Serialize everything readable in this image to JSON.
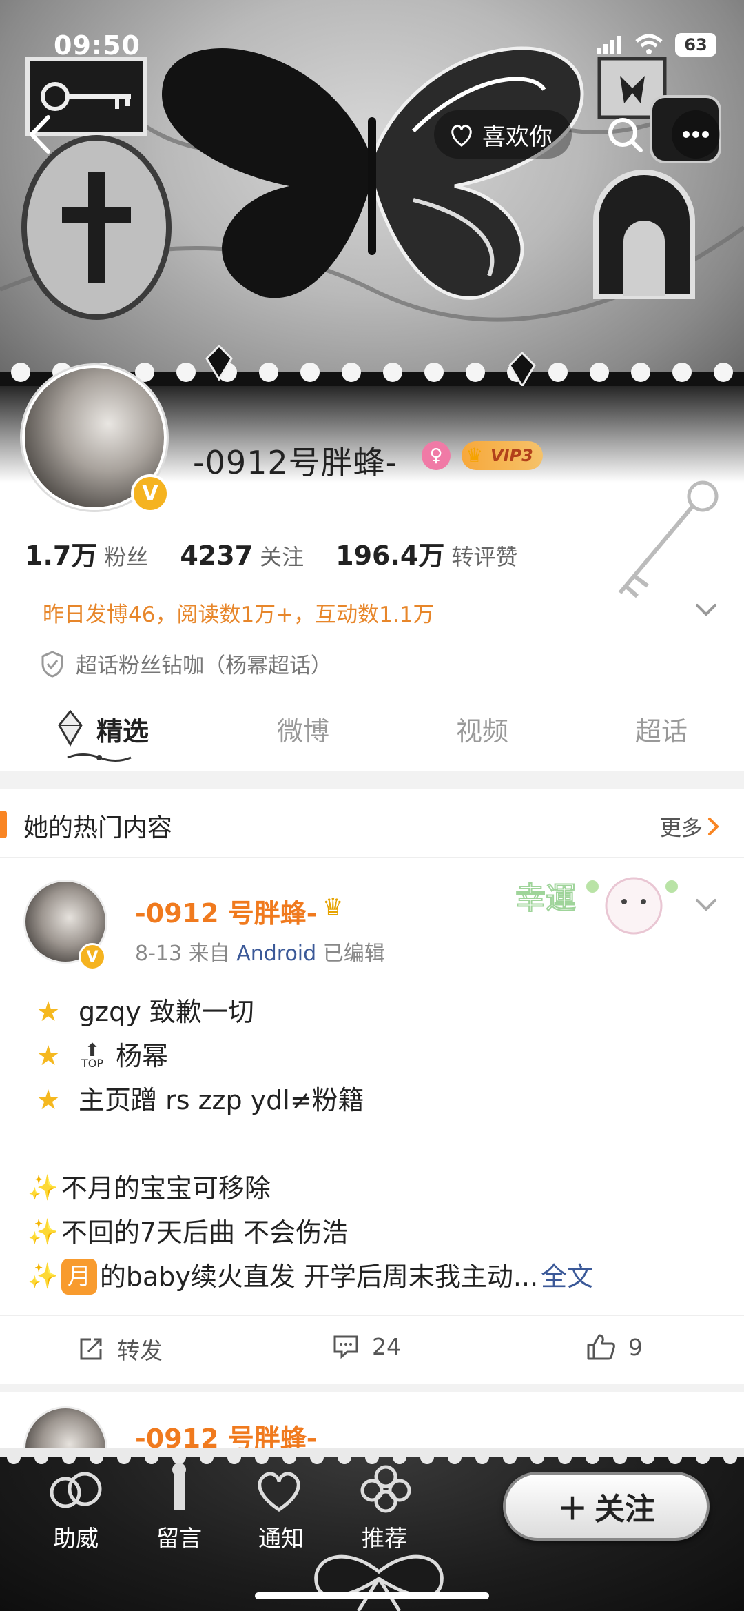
{
  "status": {
    "time": "09:50",
    "battery": "63"
  },
  "topnav": {
    "like_label": "喜欢你"
  },
  "profile": {
    "username": "-0912号胖蜂-",
    "gender_icon": "♀",
    "vip_label": "VIP3",
    "stats": [
      {
        "num": "1.7万",
        "label": "粉丝"
      },
      {
        "num": "4237",
        "label": "关注"
      },
      {
        "num": "196.4万",
        "label": "转评赞"
      }
    ],
    "yesterday_stats": "昨日发博46，阅读数1万+，互动数1.1万",
    "topic_badge": "超话粉丝钻咖（杨幂超话）"
  },
  "tabs": [
    "精选",
    "微博",
    "视频",
    "超话"
  ],
  "hot": {
    "title": "她的热门内容",
    "more": "更多"
  },
  "post": {
    "author": "-0912 号胖蜂-",
    "date": "8-13",
    "from_prefix": "来自",
    "source": "Android",
    "edited": "已编辑",
    "lines": {
      "l1": "gzqy 致歉一切",
      "l2_top": "TOP",
      "l2": "杨幂",
      "l3": "主页蹭 rs zzp ydl≠粉籍",
      "l4": "不月的宝宝可移除",
      "l5": "不回的7天后曲 不会伤浩",
      "l6_tag": "月",
      "l6": "的baby续火直发 开学后周末我主动...",
      "full_text": "全文"
    },
    "actions": {
      "repost": "转发",
      "comments": "24",
      "likes": "9"
    },
    "sticker_text": "幸運"
  },
  "post2": {
    "author": "-0912 号胖蜂-"
  },
  "bottombar": {
    "items": [
      "助威",
      "留言",
      "通知",
      "推荐"
    ],
    "follow": "关注"
  },
  "colors": {
    "accent_orange": "#f07a1e",
    "link_blue": "#3b5998",
    "vip_gold": "#f5b320"
  }
}
